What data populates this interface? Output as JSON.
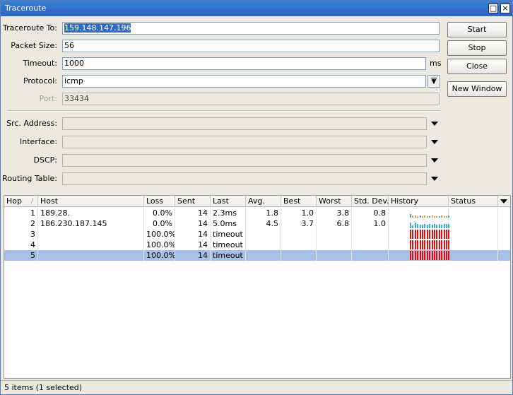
{
  "window": {
    "title": "Traceroute"
  },
  "form": {
    "traceroute_to": {
      "label": "Traceroute To:",
      "value": "159.148.147.196"
    },
    "packet_size": {
      "label": "Packet Size:",
      "value": "56"
    },
    "timeout": {
      "label": "Timeout:",
      "value": "1000",
      "unit": "ms"
    },
    "protocol": {
      "label": "Protocol:",
      "value": "icmp"
    },
    "port": {
      "label": "Port:",
      "value": "33434"
    },
    "src_address": {
      "label": "Src. Address:",
      "value": ""
    },
    "interface": {
      "label": "Interface:",
      "value": ""
    },
    "dscp": {
      "label": "DSCP:",
      "value": ""
    },
    "routing_table": {
      "label": "Routing Table:",
      "value": ""
    }
  },
  "buttons": {
    "start": "Start",
    "stop": "Stop",
    "close": "Close",
    "new_window": "New Window"
  },
  "table": {
    "columns": [
      "Hop",
      "Host",
      "Loss",
      "Sent",
      "Last",
      "Avg.",
      "Best",
      "Worst",
      "Std. Dev.",
      "History",
      "Status"
    ],
    "sort_indicator": "/",
    "rows": [
      {
        "hop": "1",
        "host": "189.28.",
        "loss": "0.0%",
        "sent": "14",
        "last": "2.3ms",
        "avg": "1.8",
        "best": "1.0",
        "worst": "3.8",
        "std": "0.8",
        "status": ""
      },
      {
        "hop": "2",
        "host": "186.230.187.145",
        "loss": "0.0%",
        "sent": "14",
        "last": "5.0ms",
        "avg": "4.5",
        "best": "3.7",
        "worst": "6.8",
        "std": "1.0",
        "status": ""
      },
      {
        "hop": "3",
        "host": "",
        "loss": "100.0%",
        "sent": "14",
        "last": "timeout",
        "avg": "",
        "best": "",
        "worst": "",
        "std": "",
        "status": ""
      },
      {
        "hop": "4",
        "host": "",
        "loss": "100.0%",
        "sent": "14",
        "last": "timeout",
        "avg": "",
        "best": "",
        "worst": "",
        "std": "",
        "status": ""
      },
      {
        "hop": "5",
        "host": "",
        "loss": "100.0%",
        "sent": "14",
        "last": "timeout",
        "avg": "",
        "best": "",
        "worst": "",
        "std": "",
        "status": ""
      }
    ]
  },
  "status_bar": "5 items (1 selected)",
  "colors": {
    "history_ok_1": "#e0a030",
    "history_ok_2": "#3bb0c8",
    "history_timeout": "#e01010",
    "selection": "#a6c0e6"
  }
}
